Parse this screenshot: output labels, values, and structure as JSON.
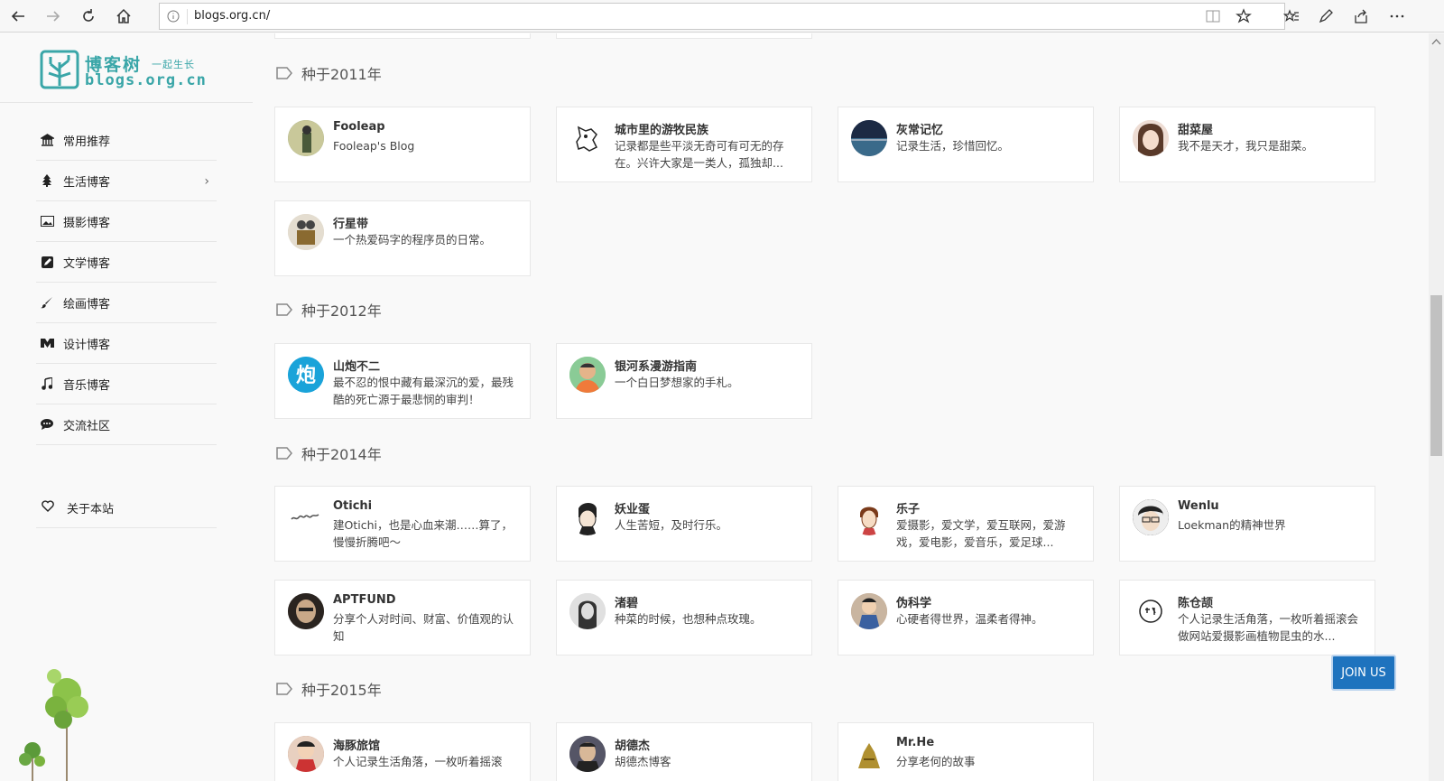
{
  "browser": {
    "url": "blogs.org.cn/"
  },
  "logo": {
    "cn": "博客树",
    "sub": "一起生长",
    "en": "blogs.org.cn"
  },
  "menu": [
    {
      "label": "常用推荐",
      "icon": "bank-icon"
    },
    {
      "label": "生活博客",
      "icon": "tree-icon",
      "has_submenu": true
    },
    {
      "label": "摄影博客",
      "icon": "image-icon"
    },
    {
      "label": "文学博客",
      "icon": "edit-icon"
    },
    {
      "label": "绘画博客",
      "icon": "brush-icon"
    },
    {
      "label": "设计博客",
      "icon": "design-icon"
    },
    {
      "label": "音乐博客",
      "icon": "music-icon"
    },
    {
      "label": "交流社区",
      "icon": "chat-icon"
    }
  ],
  "about": {
    "label": "关于本站",
    "icon": "heart-icon"
  },
  "sections": [
    {
      "title": "种于2011年",
      "cards": [
        {
          "name": "Fooleap",
          "desc": "Fooleap's Blog",
          "avatar_color": "#8a9a6a"
        },
        {
          "name": "城市里的游牧民族",
          "desc": "记录都是些平淡无奇可有可无的存在。兴许大家是一类人，孤独却...",
          "avatar_color": "#dddddd"
        },
        {
          "name": "灰常记忆",
          "desc": "记录生活，珍惜回忆。",
          "avatar_color": "#2c4a6a"
        },
        {
          "name": "甜菜屋",
          "desc": "我不是天才，我只是甜菜。",
          "avatar_color": "#c99a86"
        },
        {
          "name": "行星带",
          "desc": "一个热爱码字的程序员的日常。",
          "avatar_color": "#6b5040"
        }
      ]
    },
    {
      "title": "种于2012年",
      "cards": [
        {
          "name": "山炮不二",
          "desc": "最不忍的恨中藏有最深沉的爱，最残酷的死亡源于最悲悯的审判！",
          "avatar_color": "#1aa3d9"
        },
        {
          "name": "银河系漫游指南",
          "desc": "一个白日梦想家的手札。",
          "avatar_color": "#f07a3a"
        }
      ]
    },
    {
      "title": "种于2014年",
      "cards": [
        {
          "name": "Otichi",
          "desc": "建Otichi，也是心血来潮……算了，慢慢折腾吧～",
          "avatar_color": "#f4f4f4"
        },
        {
          "name": "妖业蛋",
          "desc": "人生苦短，及时行乐。",
          "avatar_color": "#e8e8e8"
        },
        {
          "name": "乐子",
          "desc": "爱摄影，爱文学，爱互联网，爱游戏，爱电影，爱音乐，爱足球...",
          "avatar_color": "#f1e6da"
        },
        {
          "name": "Wenlu",
          "desc": "Loekman的精神世界",
          "avatar_color": "#3a3a3a"
        },
        {
          "name": "APTFUND",
          "desc": "分享个人对时间、财富、价值观的认知",
          "avatar_color": "#6a5a50"
        },
        {
          "name": "渚碧",
          "desc": "种菜的时候，也想种点玫瑰。",
          "avatar_color": "#9a9a9a"
        },
        {
          "name": "伪科学",
          "desc": "心硬者得世界，温柔者得神。",
          "avatar_color": "#b08a70"
        },
        {
          "name": "陈仓颉",
          "desc": "个人记录生活角落，一枚听着摇滚会做网站爱摄影画植物昆虫的水...",
          "avatar_color": "#ffffff"
        }
      ]
    },
    {
      "title": "种于2015年",
      "cards": [
        {
          "name": "海豚旅馆",
          "desc": "个人记录生活角落，一枚听着摇滚",
          "avatar_color": "#a06a5a"
        },
        {
          "name": "胡德杰",
          "desc": "胡德杰博客",
          "avatar_color": "#3a3a3a"
        },
        {
          "name": "Mr.He",
          "desc": "分享老何的故事",
          "avatar_color": "#b09030"
        }
      ]
    }
  ],
  "join_button": {
    "label": "JOIN US",
    "color": "#1e73be"
  }
}
